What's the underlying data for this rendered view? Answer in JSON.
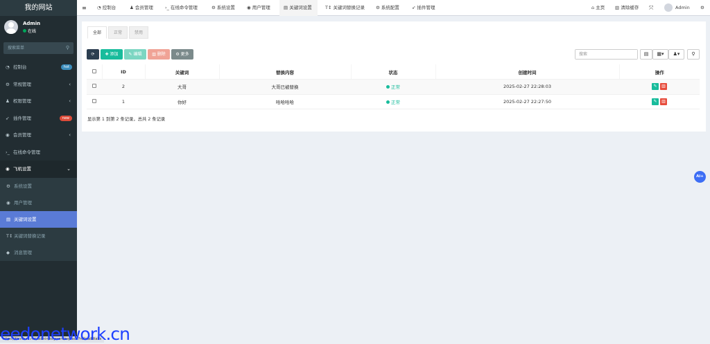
{
  "app": {
    "site_title": "我的网站"
  },
  "user": {
    "name": "Admin",
    "status": "在线"
  },
  "sidebar": {
    "search_placeholder": "搜索菜单",
    "items": [
      {
        "label": "控制台",
        "badge": "hot",
        "badge_color": "#3c8dbc"
      },
      {
        "label": "常规管理"
      },
      {
        "label": "权限管理"
      },
      {
        "label": "插件管理",
        "badge": "new",
        "badge_color": "#dd4b39"
      },
      {
        "label": "会员管理"
      },
      {
        "label": "在线命令管理"
      },
      {
        "label": "飞机设置"
      }
    ],
    "sub_items": [
      {
        "label": "系统设置"
      },
      {
        "label": "用户管理"
      },
      {
        "label": "关键词设置"
      },
      {
        "label": "关键词替换记录"
      },
      {
        "label": "消息管理"
      }
    ]
  },
  "topbar": {
    "tabs": [
      {
        "label": "控制台"
      },
      {
        "label": "会员管理"
      },
      {
        "label": "在线命令管理"
      },
      {
        "label": "系统设置"
      },
      {
        "label": "用户管理"
      },
      {
        "label": "关键词设置"
      },
      {
        "label": "关键词替换记录"
      },
      {
        "label": "系统配置"
      },
      {
        "label": "插件管理"
      }
    ],
    "home": "主页",
    "clear_cache": "清除缓存",
    "admin": "Admin"
  },
  "filter_tabs": [
    {
      "label": "全部"
    },
    {
      "label": "正常"
    },
    {
      "label": "禁用"
    }
  ],
  "toolbar": {
    "add": "添加",
    "edit": "编辑",
    "delete": "删除",
    "more": "更多",
    "search_placeholder": "搜索"
  },
  "colors": {
    "refresh": "#2c3e50",
    "add": "#18bc9c",
    "edit": "#7cd6c2",
    "delete": "#f0a396",
    "more": "#95a5a6"
  },
  "table": {
    "headers": [
      "ID",
      "关键词",
      "替换内容",
      "状态",
      "创建时间",
      "操作"
    ],
    "rows": [
      {
        "id": "2",
        "keyword": "大哥",
        "replacement": "大哥已被替换",
        "status": "正常",
        "created": "2025-02-27 22:28:03"
      },
      {
        "id": "1",
        "keyword": "你好",
        "replacement": "哈哈哈哈",
        "status": "正常",
        "created": "2025-02-27 22:27:50"
      }
    ]
  },
  "summary": "显示第 1 到第 2 条记录，总共 2 条记录",
  "fab": "Ai+",
  "status_bar": "https://thisTaaa.net/admin/keyword/replace?ref=addtabs",
  "watermark": "eedonetwork.cn"
}
